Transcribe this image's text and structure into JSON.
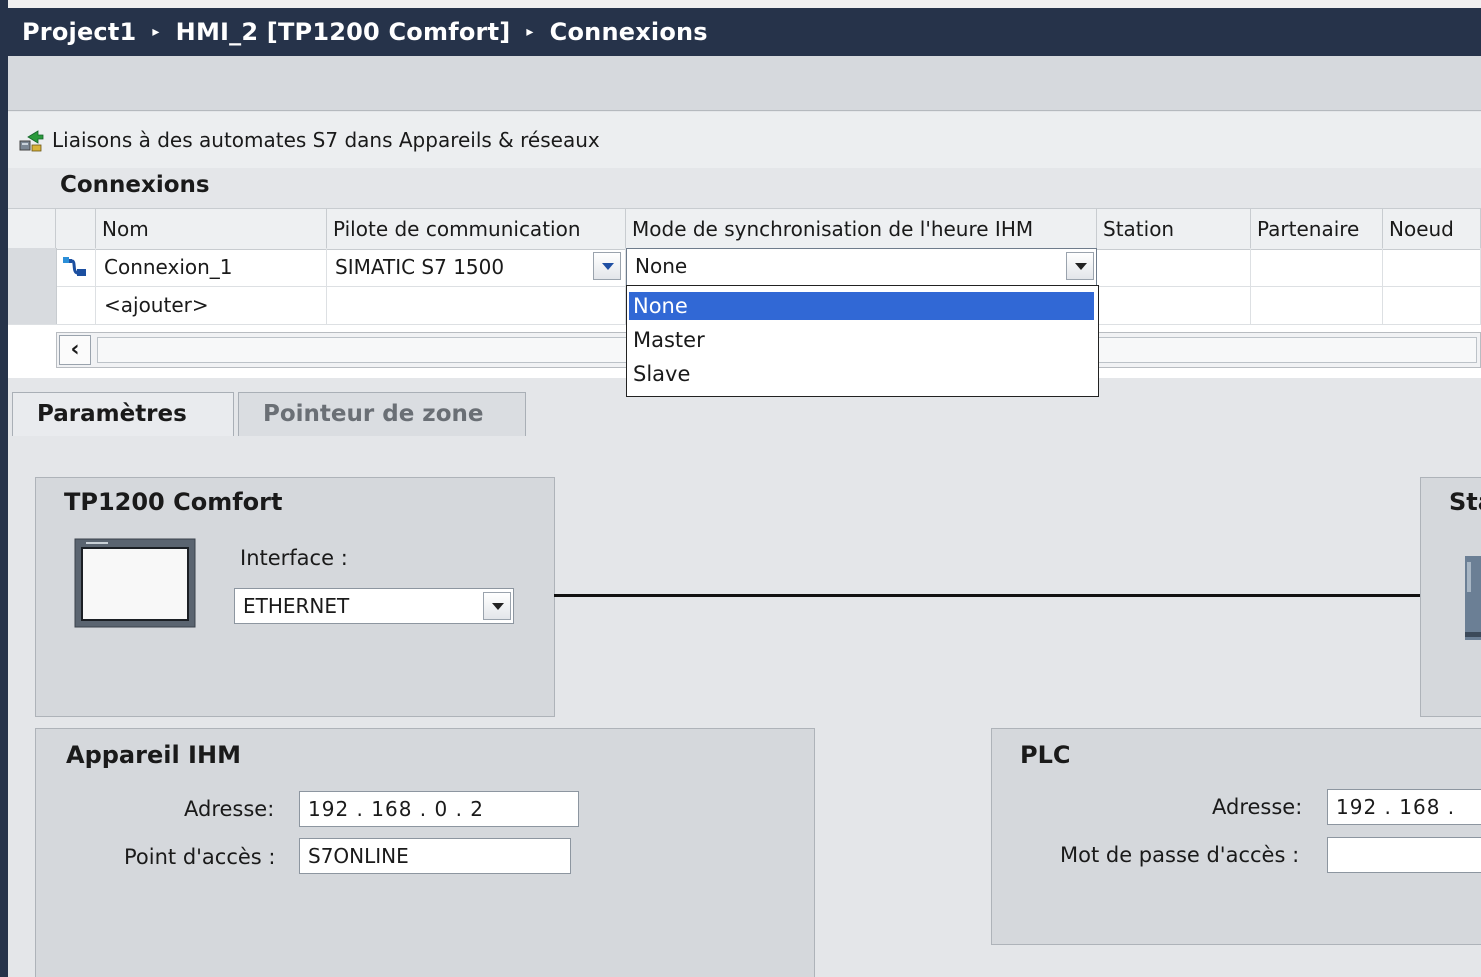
{
  "breadcrumb": {
    "project": "Project1",
    "device": "HMI_2 [TP1200 Comfort]",
    "page": "Connexions",
    "separator": "▸"
  },
  "liaisons_link": "Liaisons à des automates S7 dans Appareils & réseaux",
  "connexions_title": "Connexions",
  "table": {
    "headers": [
      "Nom",
      "Pilote de communication",
      "Mode de synchronisation de l'heure IHM",
      "Station",
      "Partenaire",
      "Noeud"
    ],
    "rows": [
      {
        "name": "Connexion_1",
        "driver": "SIMATIC S7 1500",
        "sync_mode": "None"
      },
      {
        "name": "<ajouter>"
      }
    ]
  },
  "sync_dropdown": {
    "options": [
      "None",
      "Master",
      "Slave"
    ],
    "selected": "None"
  },
  "tabs": [
    "Paramètres",
    "Pointeur de zone"
  ],
  "device_panel": {
    "title": "TP1200 Comfort",
    "interface_label": "Interface :",
    "interface_value": "ETHERNET"
  },
  "station_panel": {
    "title": "Sta"
  },
  "hmi_panel": {
    "title": "Appareil IHM",
    "address_label": "Adresse:",
    "address_value": "192 . 168 . 0    . 2",
    "access_label": "Point d'accès :",
    "access_value": "S7ONLINE"
  },
  "plc_panel": {
    "title": "PLC",
    "address_label": "Adresse:",
    "address_value": "192 . 168 .",
    "password_label": "Mot de passe d'accès :",
    "password_value": ""
  },
  "colors": {
    "titlebar": "#26334a",
    "selection": "#3168d5",
    "panel": "#d5d8dc"
  },
  "icons": [
    "connection-link-icon",
    "connection-row-icon",
    "chevron-down-icon",
    "scroll-left-icon",
    "hmi-device-icon",
    "plc-device-icon"
  ]
}
